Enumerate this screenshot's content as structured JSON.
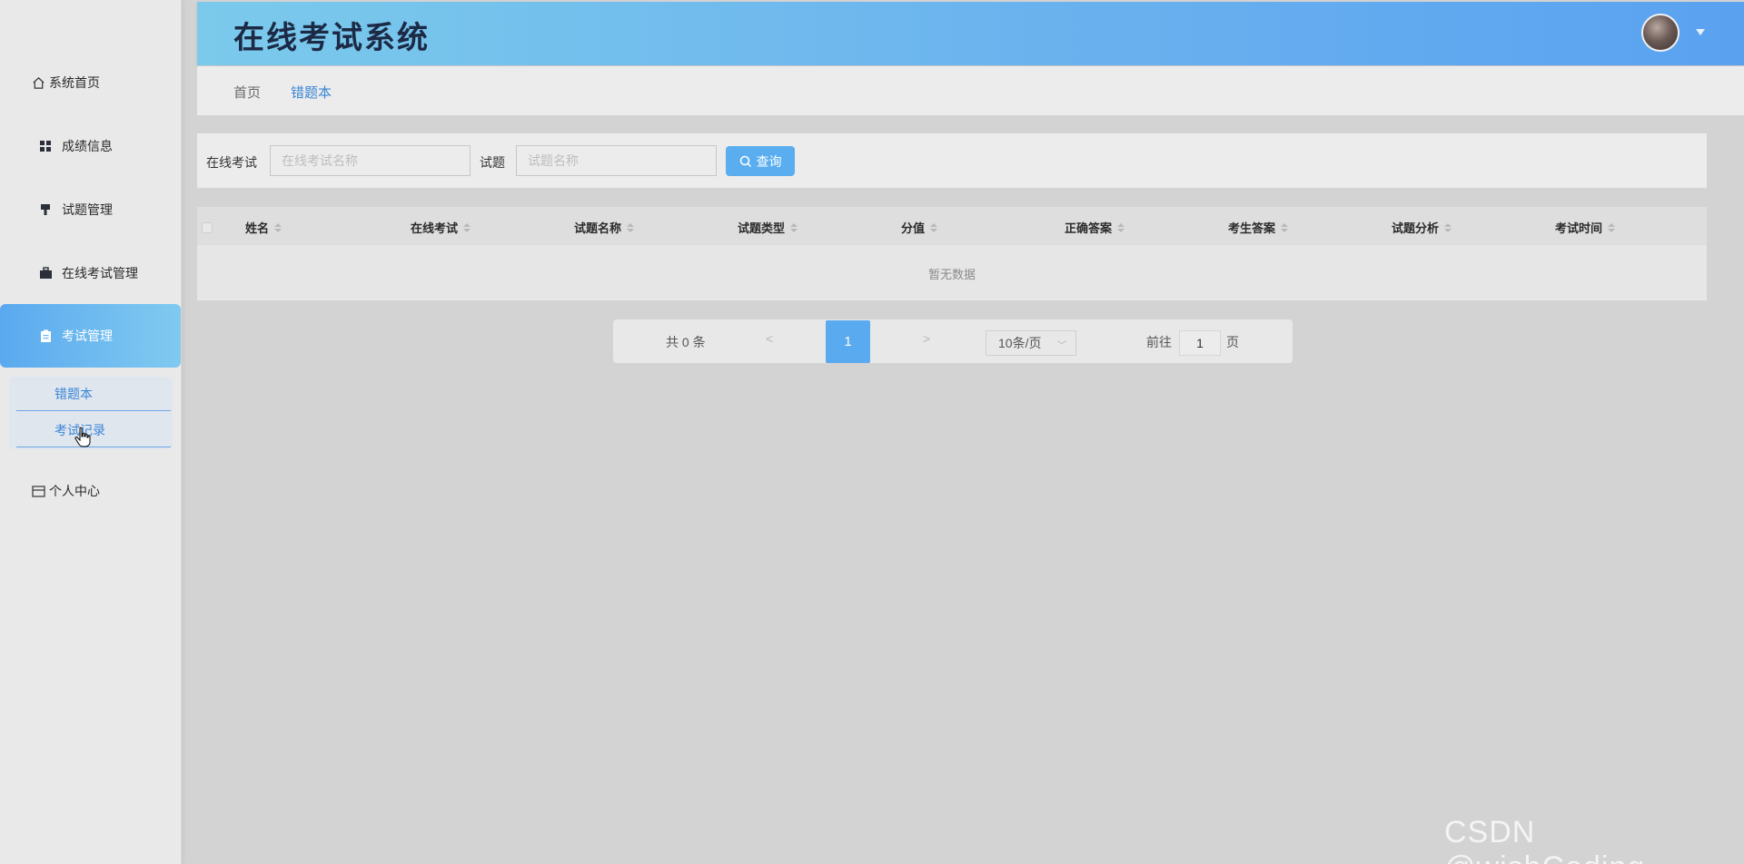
{
  "app": {
    "title": "在线考试系统"
  },
  "sidebar": {
    "items": [
      {
        "label": "系统首页",
        "icon": "home-icon"
      },
      {
        "label": "成绩信息",
        "icon": "grid-icon"
      },
      {
        "label": "试题管理",
        "icon": "brush-icon"
      },
      {
        "label": "在线考试管理",
        "icon": "briefcase-icon"
      },
      {
        "label": "考试管理",
        "icon": "clipboard-icon"
      },
      {
        "label": "个人中心",
        "icon": "card-icon"
      }
    ],
    "submenu": [
      {
        "label": "错题本"
      },
      {
        "label": "考试记录"
      }
    ]
  },
  "breadcrumb": {
    "home": "首页",
    "current": "错题本"
  },
  "search": {
    "exam_label": "在线考试",
    "exam_placeholder": "在线考试名称",
    "question_label": "试题",
    "question_placeholder": "试题名称",
    "button_label": "查询"
  },
  "table": {
    "columns": [
      "姓名",
      "在线考试",
      "试题名称",
      "试题类型",
      "分值",
      "正确答案",
      "考生答案",
      "试题分析",
      "考试时间"
    ],
    "empty_text": "暂无数据"
  },
  "pagination": {
    "total_text": "共 0 条",
    "prev": "<",
    "current_page": "1",
    "next": ">",
    "page_size": "10条/页",
    "goto_label": "前往",
    "goto_value": "1",
    "goto_unit": "页"
  },
  "watermark": "CSDN @wishCoding",
  "colors": {
    "accent": "#5aaaf0",
    "header_start": "#7bcaec",
    "header_end": "#5aa2f0",
    "active_text": "#3a86d6"
  }
}
